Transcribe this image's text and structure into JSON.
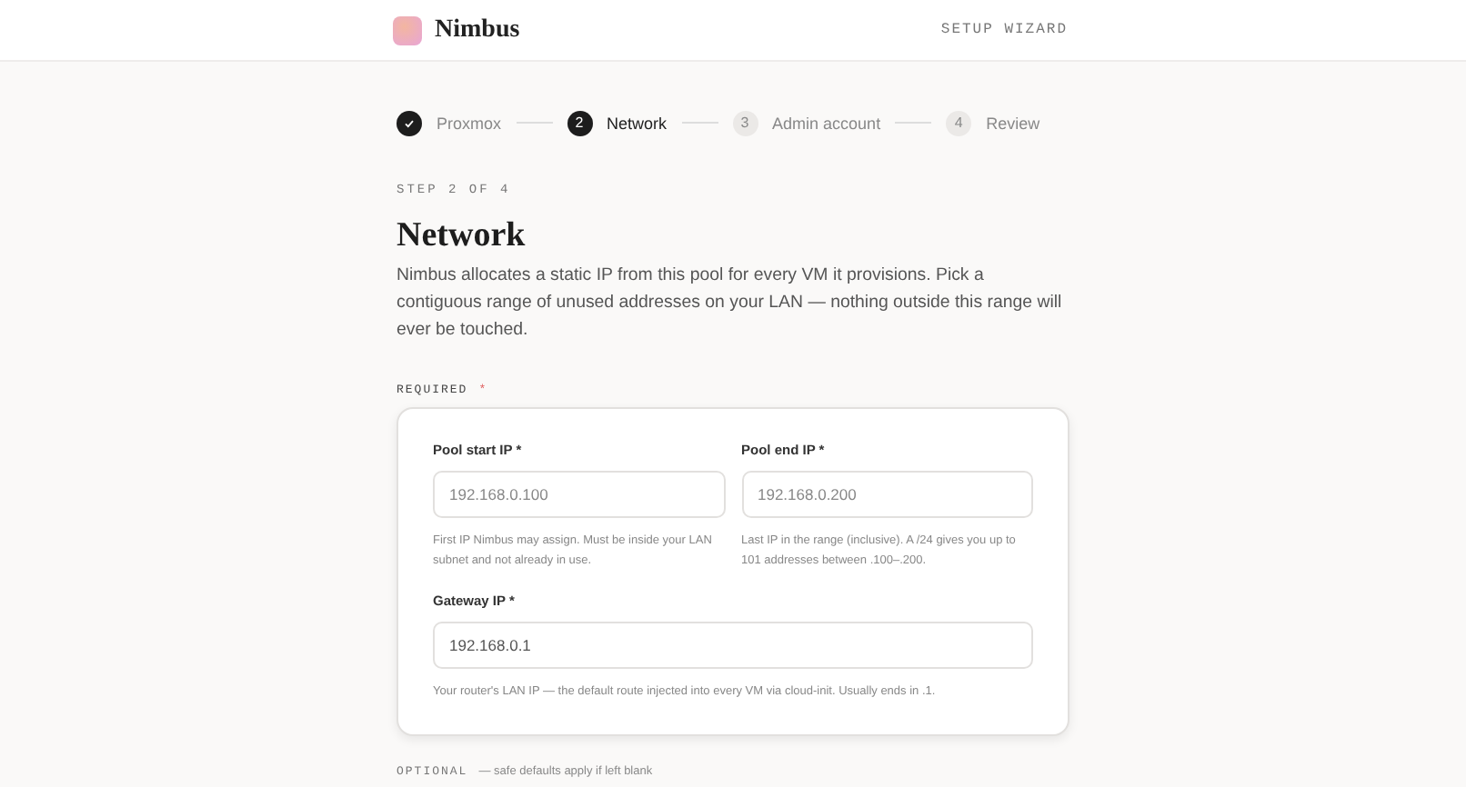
{
  "header": {
    "brand": "Nimbus",
    "caption": "SETUP WIZARD"
  },
  "steps": [
    {
      "label": "Proxmox",
      "done": true,
      "selected": false
    },
    {
      "number": "2",
      "label": "Network",
      "done": false,
      "selected": true
    },
    {
      "number": "3",
      "label": "Admin account",
      "done": false,
      "selected": false
    },
    {
      "number": "4",
      "label": "Review",
      "done": false,
      "selected": false
    }
  ],
  "eyebrow": "STEP 2 OF 4",
  "title": "Network",
  "intro": "Nimbus allocates a static IP from this pool for every VM it provisions. Pick a contiguous range of unused addresses on your LAN — nothing outside this range will ever be touched.",
  "required_section": {
    "label": "REQUIRED",
    "marker": "*",
    "fields": [
      {
        "label": "Pool start IP *",
        "placeholder": "192.168.0.100",
        "hint": "First IP Nimbus may assign. Must be inside your LAN subnet and not already in use.",
        "wide": false
      },
      {
        "label": "Pool end IP *",
        "placeholder": "192.168.0.200",
        "hint": "Last IP in the range (inclusive). A /24 gives you up to 101 addresses between .100–.200.",
        "wide": false
      },
      {
        "label": "Gateway IP *",
        "value": "192.168.0.1",
        "hint": "Your router's LAN IP — the default route injected into every VM via cloud-init. Usually ends in .1.",
        "wide": true
      }
    ]
  },
  "optional_section": {
    "label": "OPTIONAL",
    "note": "— safe defaults apply if left blank"
  }
}
